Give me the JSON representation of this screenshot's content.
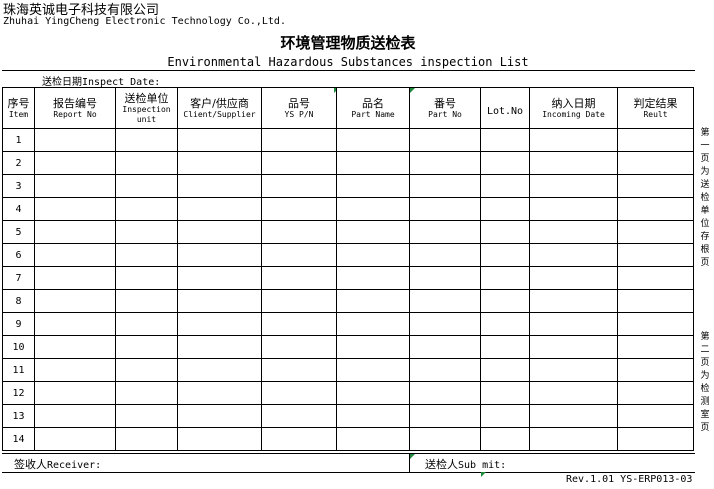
{
  "company": {
    "name_cn": "珠海英诚电子科技有限公司",
    "name_en": "Zhuhai YingCheng Electronic Technology Co.,Ltd."
  },
  "form": {
    "title_cn": "环境管理物质送检表",
    "title_en": "Environmental Hazardous Substances inspection List",
    "date_label_cn": "送检日期",
    "date_label_en": "Inspect Date:"
  },
  "table": {
    "columns": [
      {
        "cn": "序号",
        "en": "Item"
      },
      {
        "cn": "报告编号",
        "en": "Report No"
      },
      {
        "cn": "送检单位",
        "en": "Inspection unit"
      },
      {
        "cn": "客户/供应商",
        "en": "Client/Supplier"
      },
      {
        "cn": "品号",
        "en": "YS P/N"
      },
      {
        "cn": "品名",
        "en": "Part Name"
      },
      {
        "cn": "番号",
        "en": "Part No"
      },
      {
        "cn": "",
        "en": "Lot.No"
      },
      {
        "cn": "纳入日期",
        "en": "Incoming Date"
      },
      {
        "cn": "判定结果",
        "en": "Reult"
      }
    ],
    "rows": [
      "1",
      "2",
      "3",
      "4",
      "5",
      "6",
      "7",
      "8",
      "9",
      "10",
      "11",
      "12",
      "13",
      "14"
    ]
  },
  "footer": {
    "receiver_cn": "签收人",
    "receiver_en": "Receiver:",
    "submit_cn": "送检人",
    "submit_en": "Sub mit:",
    "revision": "Rev.1.01 YS-ERP013-03"
  },
  "side_notes": {
    "page1": "第一页为送检单位存根页",
    "page2": "第二页为检测室页"
  }
}
